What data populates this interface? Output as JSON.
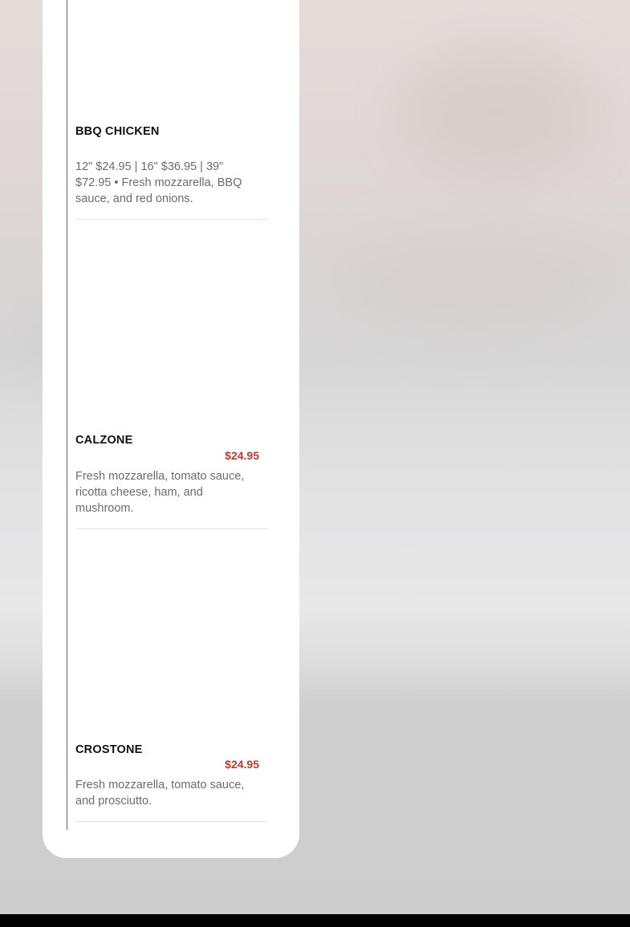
{
  "menu": {
    "items": [
      {
        "name": "BBQ CHICKEN",
        "price": "",
        "description": "12\" $24.95 | 16\" $36.95 | 39\" $72.95 • Fresh mozzarella, BBQ sauce, and red onions."
      },
      {
        "name": "CALZONE",
        "price": "$24.95",
        "description": "Fresh mozzarella, tomato sauce, ricotta cheese, ham, and mushroom."
      },
      {
        "name": "CROSTONE",
        "price": "$24.95",
        "description": "Fresh mozzarella, tomato sauce, and prosciutto."
      }
    ]
  },
  "colors": {
    "accent": "#c0392b",
    "card_background": "#ffffff",
    "text_primary": "#111111",
    "text_secondary": "#6b6b6b"
  }
}
